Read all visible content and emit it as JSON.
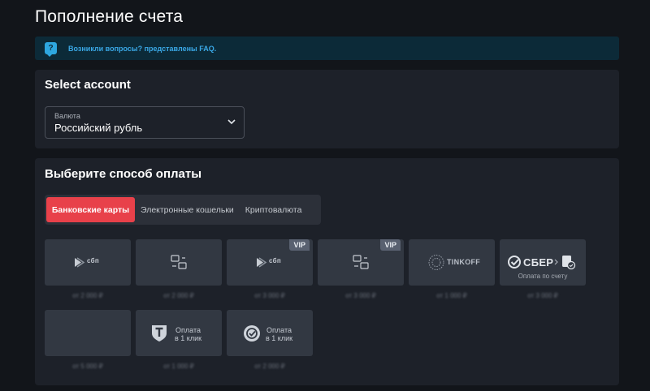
{
  "page": {
    "title": "Пополнение счета"
  },
  "faq": {
    "text": "Возникли вопросы? представлены FAQ.",
    "icon": "chat-question-icon"
  },
  "account": {
    "title": "Select account",
    "currency_label": "Валюта",
    "currency_value": "Российский рубль"
  },
  "payment": {
    "title": "Выберите способ оплаты",
    "tabs": [
      {
        "label": "Банковские карты",
        "active": true
      },
      {
        "label": "Электронные кошельки",
        "active": false
      },
      {
        "label": "Криптовалюта",
        "active": false
      }
    ],
    "methods": [
      {
        "name": "sbp",
        "icon": "sbp-icon",
        "logo_text": "сбп",
        "vip": "",
        "amount": "от 2 000 ₽"
      },
      {
        "name": "transfer",
        "icon": "transfer-icon",
        "vip": "",
        "amount": "от 2 000 ₽"
      },
      {
        "name": "sbp-vip",
        "icon": "sbp-icon",
        "logo_text": "сбп",
        "vip": "VIP",
        "amount": "от 3 000 ₽"
      },
      {
        "name": "transfer-vip",
        "icon": "transfer-icon",
        "vip": "VIP",
        "amount": "от 3 000 ₽"
      },
      {
        "name": "tinkoff",
        "icon": "tinkoff-logo",
        "logo_text": "TINKOFF",
        "vip": "",
        "amount": "от 1 000 ₽"
      },
      {
        "name": "sber",
        "icon": "sber-logo",
        "logo_text": "СБЕР",
        "sub": "Оплата по счету",
        "vip": "",
        "amount": "от 3 000 ₽"
      },
      {
        "name": "empty",
        "icon": "",
        "vip": "",
        "amount": "от 5 000 ₽"
      },
      {
        "name": "tinkoff-oneclick",
        "icon": "tinkoff-t-icon",
        "logo_text": "Оплата\nв 1 клик",
        "vip": "",
        "amount": "от 1 000 ₽"
      },
      {
        "name": "sber-oneclick",
        "icon": "sber-check-icon",
        "logo_text": "Оплата\nв 1 клик",
        "vip": "",
        "amount": "от 2 000 ₽"
      }
    ]
  },
  "colors": {
    "accent": "#e8414a",
    "faq_bg": "#0c2a38",
    "faq_text": "#3aa8e6",
    "card_bg": "#1d2129",
    "tile_bg": "#323842"
  }
}
